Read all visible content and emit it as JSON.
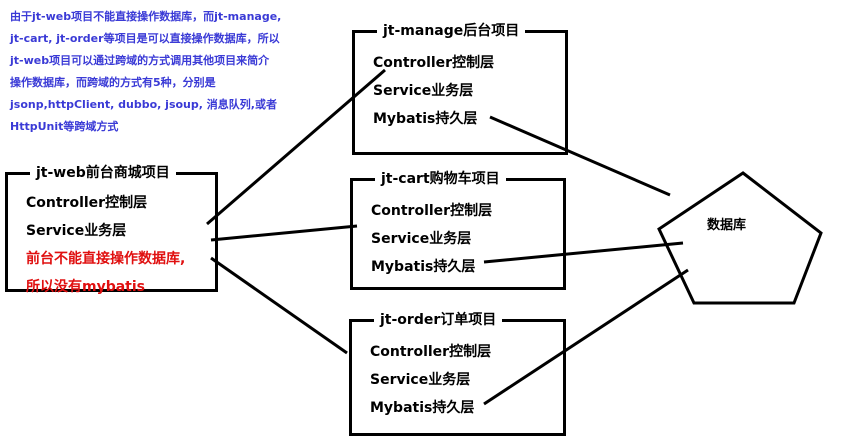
{
  "note": {
    "text": "由于jt-web项目不能直接操作数据库，而jt-manage,\njt-cart, jt-order等项目是可以直接操作数据库，所以\njt-web项目可以通过跨域的方式调用其他项目来简介\n操作数据库，而跨域的方式有5种，分别是\njsonp,httpClient, dubbo, jsoup, 消息队列,或者\nHttpUnit等跨域方式",
    "color": "#3a3ad6"
  },
  "web": {
    "title": "jt-web前台商城项目",
    "layer_controller": "Controller控制层",
    "layer_service": "Service业务层",
    "warning_line1": "前台不能直接操作数据库,",
    "warning_line2": "所以没有mybatis",
    "warning_color": "#e01010"
  },
  "manage": {
    "title": "jt-manage后台项目",
    "layer_controller": "Controller控制层",
    "layer_service": "Service业务层",
    "layer_mybatis": "Mybatis持久层"
  },
  "cart": {
    "title": "jt-cart购物车项目",
    "layer_controller": "Controller控制层",
    "layer_service": "Service业务层",
    "layer_mybatis": "Mybatis持久层"
  },
  "order": {
    "title": "jt-order订单项目",
    "layer_controller": "Controller控制层",
    "layer_service": "Service业务层",
    "layer_mybatis": "Mybatis持久层"
  },
  "database": {
    "label": "数据库",
    "shape": "pentagon"
  }
}
